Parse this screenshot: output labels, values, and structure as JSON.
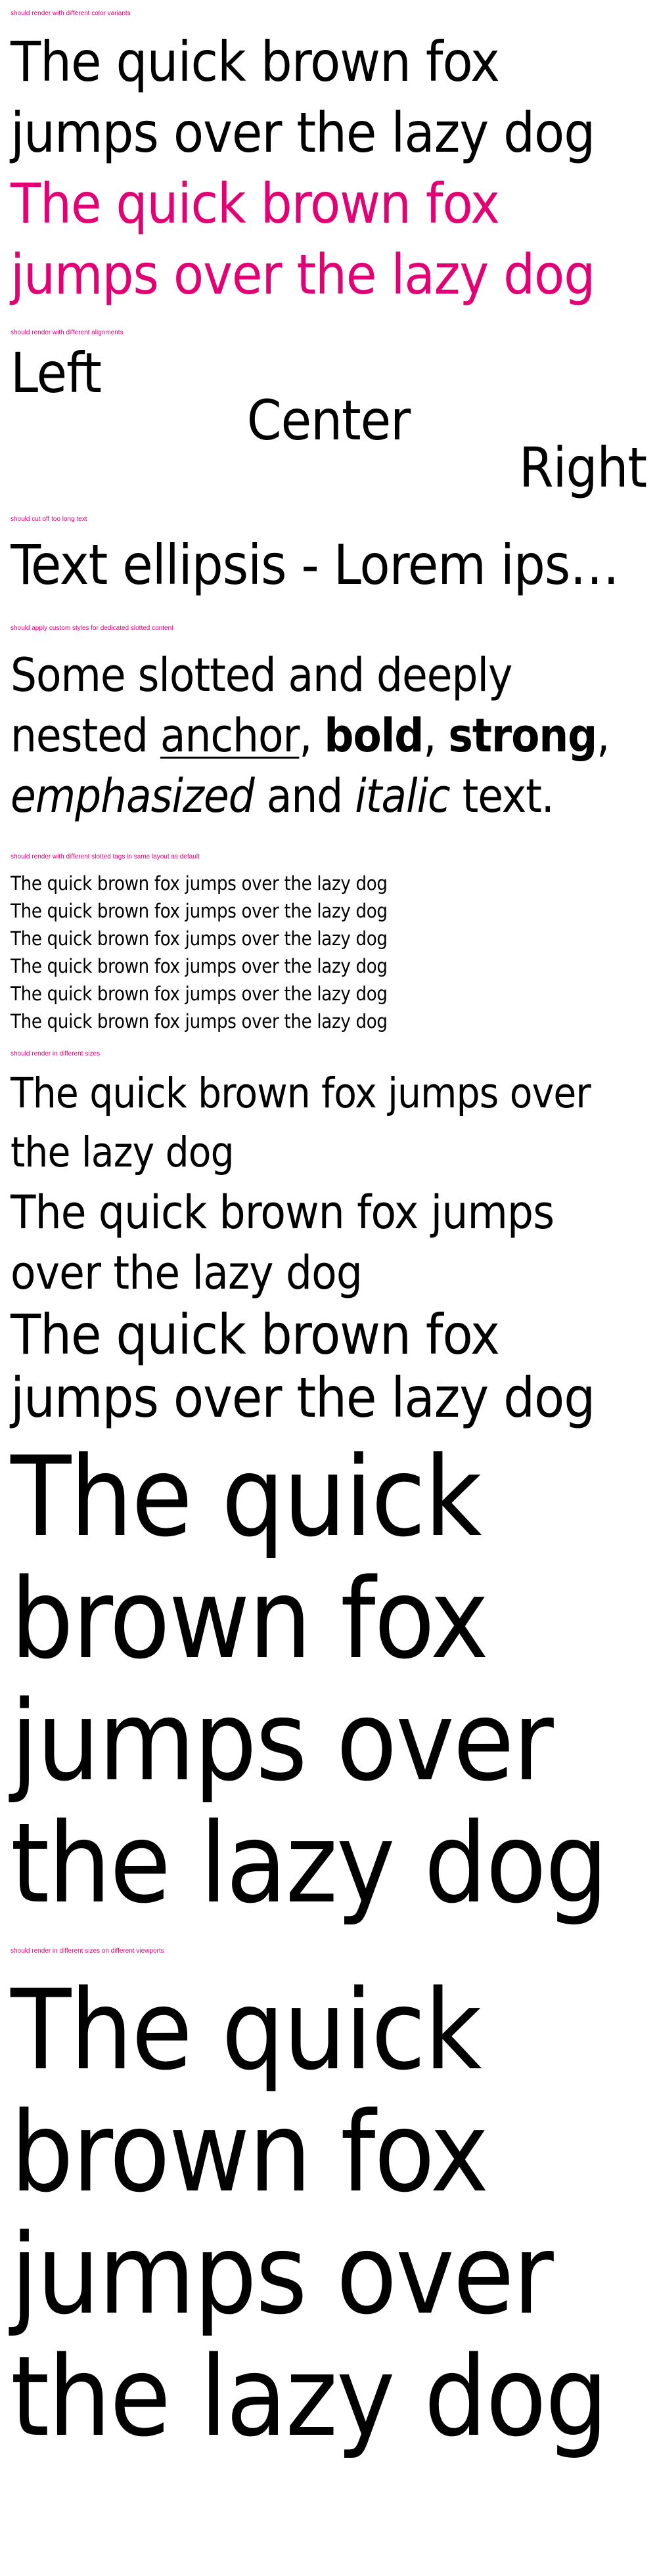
{
  "sections": {
    "color": {
      "label": "should render with different color variants",
      "line1": "The quick brown fox jumps over the lazy dog",
      "line2": "The quick brown fox jumps over the lazy dog"
    },
    "alignments": {
      "label": "should render with different alignments",
      "left": "Left",
      "center": "Center",
      "right": "Right"
    },
    "ellipsis": {
      "label": "should cut off too long text",
      "text": "Text ellipsis - Lorem ipsum dolor sit amet, consetetur sadipscing elitr, sed diam nonumy eirmod"
    },
    "slotted": {
      "label": "should apply custom styles for dedicated slotted content",
      "part1": "Some slotted and deeply nested ",
      "anchor": "anchor",
      "sep1": ", ",
      "bold": "bold",
      "sep2": ", ",
      "strong": "strong",
      "sep3": ",",
      "emphasized": "emphasized",
      "and": " and ",
      "italic": "italic",
      "end": " text."
    },
    "tags": {
      "label": "should render with different slotted tags in same layout as default",
      "lines": [
        "The quick brown fox jumps over the lazy dog",
        "The quick brown fox jumps over the lazy dog",
        "The quick brown fox jumps over the lazy dog",
        "The quick brown fox jumps over the lazy dog",
        "The quick brown fox jumps over the lazy dog",
        "The quick brown fox jumps over the lazy dog"
      ]
    },
    "sizes": {
      "label": "should render in different sizes",
      "lines": [
        "The quick brown fox jumps over the lazy dog",
        "The quick brown fox jumps over the lazy dog",
        "The quick brown fox jumps over the lazy dog",
        "The quick brown fox jumps over the lazy dog"
      ]
    },
    "viewports": {
      "label": "should render in different sizes on different viewports",
      "text": "The quick brown fox jumps over the lazy dog"
    }
  },
  "colors": {
    "accent": "#e20074",
    "default": "#000000",
    "background": "#ffffff"
  }
}
